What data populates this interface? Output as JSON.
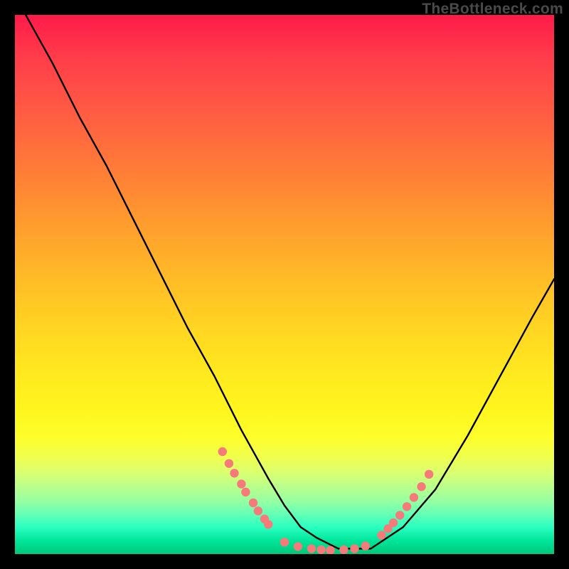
{
  "watermark": "TheBottleneck.com",
  "chart_data": {
    "type": "line",
    "title": "",
    "xlabel": "",
    "ylabel": "",
    "xlim": [
      0,
      100
    ],
    "ylim": [
      0,
      100
    ],
    "grid": false,
    "legend": false,
    "series": [
      {
        "name": "curve",
        "color": "#000000",
        "x": [
          2,
          7,
          12,
          17,
          22,
          27,
          32,
          37,
          42,
          47,
          50,
          53,
          56,
          60,
          66,
          72,
          78,
          84,
          90,
          96,
          100
        ],
        "y": [
          100,
          91,
          81,
          72,
          62,
          52,
          42,
          33,
          23,
          14,
          9,
          5,
          3,
          1,
          1,
          5,
          12,
          22,
          33,
          44,
          51
        ]
      }
    ],
    "marker_clusters": [
      {
        "name": "left-dots",
        "color": "#f77a7a",
        "x": [
          38.5,
          39.7,
          40.7,
          42.0,
          42.8,
          44.2,
          45.1,
          46.3,
          47.0
        ],
        "y": [
          19.0,
          16.8,
          15.0,
          13.0,
          11.5,
          9.5,
          8.0,
          6.5,
          5.5
        ]
      },
      {
        "name": "bottom-dots",
        "color": "#f77a7a",
        "x": [
          50.0,
          52.5,
          55.0,
          56.8,
          58.5,
          61.0,
          63.0,
          65.0
        ],
        "y": [
          2.2,
          1.4,
          1.0,
          0.8,
          0.7,
          0.8,
          1.0,
          1.5
        ]
      },
      {
        "name": "right-dots",
        "color": "#f77a7a",
        "x": [
          68.0,
          69.2,
          70.2,
          71.4,
          72.7,
          74.0,
          75.4,
          76.8
        ],
        "y": [
          3.5,
          4.7,
          5.8,
          7.2,
          8.8,
          10.5,
          12.5,
          14.8
        ]
      }
    ]
  }
}
